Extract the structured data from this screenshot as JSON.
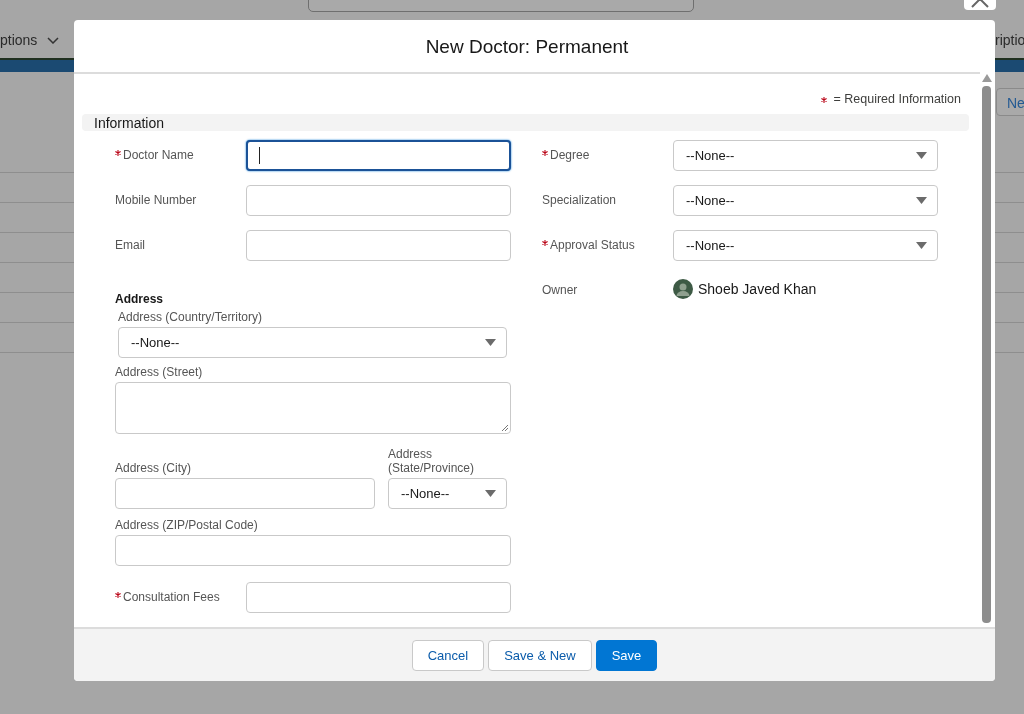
{
  "backdrop": {
    "nav_left": "ptions",
    "nav_right": "riptio",
    "link_right": "Ne"
  },
  "modal": {
    "title": "New Doctor: Permanent",
    "required_note": "= Required Information",
    "section": "Information",
    "left_fields": [
      {
        "label": "Doctor Name",
        "required": true,
        "focused": true
      },
      {
        "label": "Mobile Number",
        "required": false,
        "focused": false
      },
      {
        "label": "Email",
        "required": false,
        "focused": false
      }
    ],
    "address": {
      "heading": "Address",
      "country": {
        "label": "Address (Country/Territory)",
        "value": "--None--"
      },
      "street": {
        "label": "Address (Street)"
      },
      "city": {
        "label": "Address (City)"
      },
      "state": {
        "label": "Address (State/Province)",
        "value": "--None--"
      },
      "zip": {
        "label": "Address (ZIP/Postal Code)"
      }
    },
    "consultation": {
      "label": "Consultation Fees",
      "required": true,
      "focused": false
    },
    "right_fields": [
      {
        "kind": "select",
        "label": "Degree",
        "required": true,
        "value": "--None--"
      },
      {
        "kind": "select",
        "label": "Specialization",
        "required": false,
        "value": "--None--"
      },
      {
        "kind": "select",
        "label": "Approval Status",
        "required": true,
        "value": "--None--"
      },
      {
        "kind": "user",
        "label": "Owner",
        "required": false,
        "value": "Shoeb Javed Khan"
      }
    ],
    "buttons": [
      {
        "label": "Cancel",
        "primary": false
      },
      {
        "label": "Save & New",
        "primary": false
      },
      {
        "label": "Save",
        "primary": true
      }
    ]
  }
}
